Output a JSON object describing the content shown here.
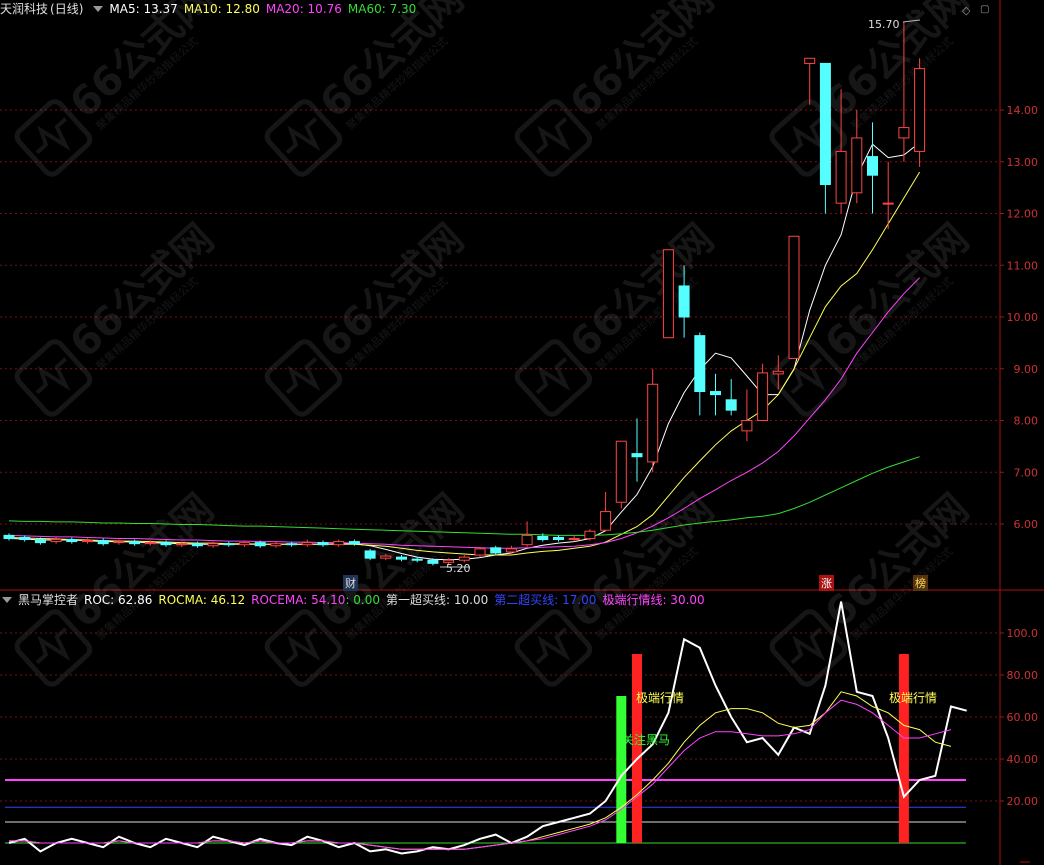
{
  "main_header": {
    "stock_name": "天润科技",
    "period": "(日线)",
    "ma5_label": "MA5: 13.37",
    "ma10_label": "MA10: 12.80",
    "ma20_label": "MA20: 10.76",
    "ma60_label": "MA60: 7.30",
    "colors": {
      "ma5": "#ffffff",
      "ma10": "#ffff55",
      "ma20": "#ff44ff",
      "ma60": "#33dd33"
    }
  },
  "main_axis": {
    "price_ticks": [
      "14.00",
      "13.00",
      "12.00",
      "11.00",
      "10.00",
      "9.00",
      "8.00",
      "7.00",
      "6.00"
    ],
    "high_annotation": "15.70",
    "low_annotation": "5.20",
    "markers": [
      "财",
      "涨",
      "榜"
    ]
  },
  "sub_header": {
    "indicator_name": "黑马掌控者",
    "roc": "ROC: 62.86",
    "rocma": "ROCMA: 46.12",
    "rocema": "ROCEMA: 54.10",
    "zero": ": 0.00",
    "line1": "第一超买线: 10.00",
    "line2": "第二超买线: 17.00",
    "line3": "极端行情线: 30.00"
  },
  "sub_axis": {
    "ticks": [
      "100.0",
      "80.00",
      "60.00",
      "40.00",
      "20.00"
    ]
  },
  "sub_annotations": {
    "extreme_1": "极端行情",
    "extreme_2": "极端行情",
    "darkhorse": "关注黑马"
  },
  "watermark": {
    "text": "66公式网",
    "subtext": "聚集精品精华炒股指标公式"
  },
  "chart_data": [
    {
      "type": "candlestick",
      "title": "天润科技 (日线)",
      "ylim": [
        5.0,
        16.0
      ],
      "candles": [
        {
          "o": 5.78,
          "c": 5.72,
          "h": 5.82,
          "l": 5.68
        },
        {
          "o": 5.74,
          "c": 5.7,
          "h": 5.78,
          "l": 5.66
        },
        {
          "o": 5.7,
          "c": 5.64,
          "h": 5.74,
          "l": 5.6
        },
        {
          "o": 5.66,
          "c": 5.7,
          "h": 5.74,
          "l": 5.62
        },
        {
          "o": 5.7,
          "c": 5.66,
          "h": 5.74,
          "l": 5.62
        },
        {
          "o": 5.66,
          "c": 5.68,
          "h": 5.72,
          "l": 5.62
        },
        {
          "o": 5.68,
          "c": 5.62,
          "h": 5.72,
          "l": 5.58
        },
        {
          "o": 5.64,
          "c": 5.66,
          "h": 5.7,
          "l": 5.6
        },
        {
          "o": 5.66,
          "c": 5.62,
          "h": 5.7,
          "l": 5.58
        },
        {
          "o": 5.62,
          "c": 5.64,
          "h": 5.68,
          "l": 5.58
        },
        {
          "o": 5.64,
          "c": 5.6,
          "h": 5.68,
          "l": 5.56
        },
        {
          "o": 5.6,
          "c": 5.62,
          "h": 5.66,
          "l": 5.56
        },
        {
          "o": 5.62,
          "c": 5.58,
          "h": 5.66,
          "l": 5.54
        },
        {
          "o": 5.58,
          "c": 5.62,
          "h": 5.66,
          "l": 5.54
        },
        {
          "o": 5.62,
          "c": 5.6,
          "h": 5.66,
          "l": 5.56
        },
        {
          "o": 5.6,
          "c": 5.64,
          "h": 5.68,
          "l": 5.56
        },
        {
          "o": 5.64,
          "c": 5.58,
          "h": 5.68,
          "l": 5.54
        },
        {
          "o": 5.58,
          "c": 5.62,
          "h": 5.66,
          "l": 5.54
        },
        {
          "o": 5.62,
          "c": 5.6,
          "h": 5.66,
          "l": 5.56
        },
        {
          "o": 5.6,
          "c": 5.64,
          "h": 5.7,
          "l": 5.56
        },
        {
          "o": 5.64,
          "c": 5.6,
          "h": 5.68,
          "l": 5.56
        },
        {
          "o": 5.6,
          "c": 5.66,
          "h": 5.7,
          "l": 5.56
        },
        {
          "o": 5.66,
          "c": 5.62,
          "h": 5.7,
          "l": 5.58
        },
        {
          "o": 5.48,
          "c": 5.34,
          "h": 5.52,
          "l": 5.3
        },
        {
          "o": 5.34,
          "c": 5.38,
          "h": 5.42,
          "l": 5.3
        },
        {
          "o": 5.36,
          "c": 5.32,
          "h": 5.4,
          "l": 5.28
        },
        {
          "o": 5.32,
          "c": 5.3,
          "h": 5.36,
          "l": 5.26
        },
        {
          "o": 5.3,
          "c": 5.24,
          "h": 5.34,
          "l": 5.2
        },
        {
          "o": 5.26,
          "c": 5.3,
          "h": 5.34,
          "l": 5.22
        },
        {
          "o": 5.3,
          "c": 5.36,
          "h": 5.4,
          "l": 5.26
        },
        {
          "o": 5.4,
          "c": 5.52,
          "h": 5.56,
          "l": 5.36
        },
        {
          "o": 5.54,
          "c": 5.44,
          "h": 5.58,
          "l": 5.4
        },
        {
          "o": 5.46,
          "c": 5.52,
          "h": 5.58,
          "l": 5.42
        },
        {
          "o": 5.6,
          "c": 5.78,
          "h": 6.05,
          "l": 5.56
        },
        {
          "o": 5.76,
          "c": 5.7,
          "h": 5.82,
          "l": 5.66
        },
        {
          "o": 5.74,
          "c": 5.7,
          "h": 5.78,
          "l": 5.66
        },
        {
          "o": 5.7,
          "c": 5.72,
          "h": 5.78,
          "l": 5.66
        },
        {
          "o": 5.72,
          "c": 5.86,
          "h": 5.9,
          "l": 5.68
        },
        {
          "o": 5.88,
          "c": 6.24,
          "h": 6.62,
          "l": 5.86
        },
        {
          "o": 6.42,
          "c": 7.6,
          "h": 7.6,
          "l": 6.3
        },
        {
          "o": 7.36,
          "c": 7.3,
          "h": 8.04,
          "l": 6.82
        },
        {
          "o": 7.2,
          "c": 8.7,
          "h": 9.0,
          "l": 7.0
        },
        {
          "o": 9.6,
          "c": 11.3,
          "h": 11.3,
          "l": 9.6
        },
        {
          "o": 10.6,
          "c": 10.0,
          "h": 11.0,
          "l": 9.6
        },
        {
          "o": 9.64,
          "c": 8.56,
          "h": 9.7,
          "l": 8.1
        },
        {
          "o": 8.56,
          "c": 8.5,
          "h": 8.9,
          "l": 8.1
        },
        {
          "o": 8.4,
          "c": 8.2,
          "h": 8.8,
          "l": 8.1
        },
        {
          "o": 7.8,
          "c": 8.0,
          "h": 8.6,
          "l": 7.6
        },
        {
          "o": 8.0,
          "c": 8.92,
          "h": 9.1,
          "l": 8.0
        },
        {
          "o": 8.9,
          "c": 8.95,
          "h": 9.26,
          "l": 8.6
        },
        {
          "o": 9.2,
          "c": 11.56,
          "h": 11.56,
          "l": 9.2
        },
        {
          "o": 14.9,
          "c": 15.0,
          "h": 15.0,
          "l": 14.1
        },
        {
          "o": 14.9,
          "c": 12.56,
          "h": 14.9,
          "l": 12.0
        },
        {
          "o": 12.2,
          "c": 13.2,
          "h": 14.4,
          "l": 12.0
        },
        {
          "o": 12.4,
          "c": 13.46,
          "h": 14.0,
          "l": 12.2
        },
        {
          "o": 13.1,
          "c": 12.74,
          "h": 13.76,
          "l": 12.0
        },
        {
          "o": 12.2,
          "c": 12.2,
          "h": 13.0,
          "l": 11.7
        },
        {
          "o": 13.46,
          "c": 13.66,
          "h": 15.7,
          "l": 13.0
        },
        {
          "o": 13.2,
          "c": 14.8,
          "h": 15.0,
          "l": 12.9
        }
      ],
      "series": [
        {
          "name": "MA5",
          "values": [
            5.72,
            5.71,
            5.69,
            5.69,
            5.69,
            5.68,
            5.66,
            5.66,
            5.65,
            5.64,
            5.63,
            5.62,
            5.61,
            5.61,
            5.61,
            5.61,
            5.61,
            5.61,
            5.61,
            5.61,
            5.61,
            5.62,
            5.62,
            5.58,
            5.51,
            5.43,
            5.36,
            5.32,
            5.31,
            5.32,
            5.35,
            5.4,
            5.44,
            5.53,
            5.59,
            5.63,
            5.66,
            5.72,
            5.87,
            6.23,
            6.57,
            7.11,
            7.94,
            8.54,
            8.98,
            9.3,
            9.21,
            8.86,
            8.5,
            8.5,
            8.99,
            10.13,
            11.0,
            11.59,
            12.72,
            13.34,
            13.08,
            13.13,
            13.37
          ]
        },
        {
          "name": "MA10",
          "values": [
            5.74,
            5.73,
            5.72,
            5.71,
            5.7,
            5.69,
            5.68,
            5.67,
            5.67,
            5.66,
            5.65,
            5.64,
            5.63,
            5.63,
            5.62,
            5.62,
            5.61,
            5.61,
            5.61,
            5.61,
            5.61,
            5.61,
            5.61,
            5.59,
            5.57,
            5.53,
            5.49,
            5.46,
            5.44,
            5.42,
            5.4,
            5.4,
            5.4,
            5.44,
            5.47,
            5.49,
            5.53,
            5.57,
            5.65,
            5.8,
            5.95,
            6.18,
            6.54,
            6.9,
            7.22,
            7.53,
            7.8,
            8.0,
            8.2,
            8.5,
            9.0,
            9.6,
            10.2,
            10.6,
            10.84,
            11.3,
            11.8,
            12.3,
            12.8
          ]
        },
        {
          "name": "MA20",
          "values": [
            5.78,
            5.77,
            5.76,
            5.75,
            5.75,
            5.74,
            5.73,
            5.72,
            5.72,
            5.71,
            5.7,
            5.69,
            5.69,
            5.68,
            5.67,
            5.67,
            5.66,
            5.66,
            5.65,
            5.65,
            5.64,
            5.64,
            5.63,
            5.62,
            5.61,
            5.59,
            5.58,
            5.57,
            5.56,
            5.55,
            5.54,
            5.53,
            5.53,
            5.54,
            5.55,
            5.56,
            5.57,
            5.6,
            5.64,
            5.72,
            5.83,
            5.96,
            6.12,
            6.3,
            6.49,
            6.66,
            6.84,
            7.0,
            7.18,
            7.4,
            7.7,
            8.05,
            8.4,
            8.8,
            9.3,
            9.7,
            10.1,
            10.45,
            10.76
          ]
        },
        {
          "name": "MA60",
          "values": [
            6.06,
            6.05,
            6.05,
            6.04,
            6.04,
            6.03,
            6.02,
            6.02,
            6.01,
            6.01,
            6.0,
            5.99,
            5.99,
            5.98,
            5.97,
            5.96,
            5.96,
            5.95,
            5.94,
            5.93,
            5.92,
            5.91,
            5.9,
            5.89,
            5.88,
            5.87,
            5.86,
            5.85,
            5.84,
            5.83,
            5.82,
            5.81,
            5.8,
            5.8,
            5.79,
            5.78,
            5.78,
            5.78,
            5.79,
            5.81,
            5.84,
            5.88,
            5.93,
            5.98,
            6.02,
            6.05,
            6.08,
            6.12,
            6.15,
            6.2,
            6.3,
            6.42,
            6.56,
            6.7,
            6.84,
            6.98,
            7.1,
            7.2,
            7.3
          ]
        }
      ]
    },
    {
      "type": "line",
      "title": "黑马掌控者",
      "ylim": [
        -5,
        118
      ],
      "series": [
        {
          "name": "ROC",
          "values": [
            0,
            2,
            -4,
            0,
            2,
            0,
            -2,
            3,
            0,
            -2,
            2,
            0,
            -2,
            3,
            1,
            -1,
            2,
            0,
            -1,
            3,
            1,
            -2,
            0,
            -4,
            -3,
            -5,
            -4,
            -2,
            -3,
            -1,
            2,
            4,
            0,
            3,
            8,
            10,
            12,
            14,
            20,
            32,
            40,
            47,
            62,
            97,
            93,
            75,
            60,
            48,
            50,
            42,
            55,
            52,
            75,
            115,
            72,
            70,
            50,
            22,
            30,
            32,
            65,
            63
          ]
        },
        {
          "name": "ROCMA",
          "values": [
            1,
            1,
            0,
            0,
            0,
            0,
            0,
            1,
            0,
            0,
            0,
            0,
            0,
            1,
            1,
            0,
            1,
            0,
            0,
            1,
            1,
            0,
            0,
            -1,
            -2,
            -3,
            -3,
            -3,
            -3,
            -3,
            -2,
            -1,
            0,
            1,
            3,
            5,
            7,
            9,
            12,
            17,
            23,
            30,
            38,
            48,
            56,
            62,
            64,
            64,
            62,
            57,
            55,
            56,
            62,
            72,
            70,
            65,
            62,
            56,
            54,
            48,
            46
          ]
        },
        {
          "name": "ROCEMA",
          "values": [
            1,
            1,
            0,
            0,
            0,
            0,
            0,
            1,
            0,
            0,
            0,
            0,
            0,
            1,
            1,
            0,
            1,
            0,
            0,
            1,
            1,
            0,
            0,
            -1,
            -2,
            -3,
            -3,
            -3,
            -3,
            -3,
            -2,
            -1,
            0,
            1,
            2,
            4,
            6,
            8,
            11,
            16,
            22,
            28,
            36,
            44,
            50,
            53,
            53,
            52,
            51,
            51,
            52,
            54,
            62,
            68,
            66,
            62,
            56,
            50,
            50,
            52,
            54
          ]
        },
        {
          "name": "第一超买线",
          "values": [
            10
          ]
        },
        {
          "name": "第二超买线",
          "values": [
            17
          ]
        },
        {
          "name": "极端行情线",
          "values": [
            30
          ]
        }
      ],
      "bars": [
        {
          "name": "关注黑马",
          "x_index": 39,
          "value": 70,
          "color": "#33ff33"
        },
        {
          "name": "极端行情",
          "x_index": 40,
          "value": 90,
          "color": "#ff2222"
        },
        {
          "name": "极端行情",
          "x_index": 57,
          "value": 90,
          "color": "#ff2222"
        }
      ]
    }
  ]
}
